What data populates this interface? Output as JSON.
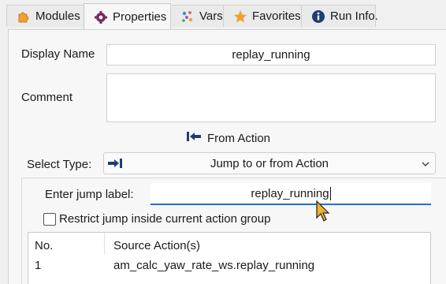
{
  "tabs": [
    {
      "label": "Modules",
      "icon": "puzzle-icon",
      "active": false
    },
    {
      "label": "Properties",
      "icon": "gear-icon",
      "active": true
    },
    {
      "label": "Vars",
      "icon": "vars-dots-icon",
      "active": false
    },
    {
      "label": "Favorites",
      "icon": "star-icon",
      "active": false
    },
    {
      "label": "Run Info.",
      "icon": "info-icon",
      "active": false
    }
  ],
  "form": {
    "display_name_label": "Display Name",
    "display_name_value": "replay_running",
    "comment_label": "Comment",
    "comment_value": "",
    "from_action_label": "From Action",
    "select_type_label": "Select Type:",
    "select_type_value": "Jump to or from Action",
    "jump_label_label": "Enter jump label:",
    "jump_label_value": "replay_running",
    "restrict_label": "Restrict jump inside current action group",
    "restrict_checked": false
  },
  "table": {
    "headers": [
      "No.",
      "Source Action(s)"
    ],
    "rows": [
      {
        "no": "1",
        "source": "am_calc_yaw_rate_ws.replay_running"
      }
    ]
  },
  "colors": {
    "accent": "#1f6fd1",
    "icon_navy": "#1d3e73",
    "star": "#f0a030",
    "gear": "#7a2a5a"
  }
}
